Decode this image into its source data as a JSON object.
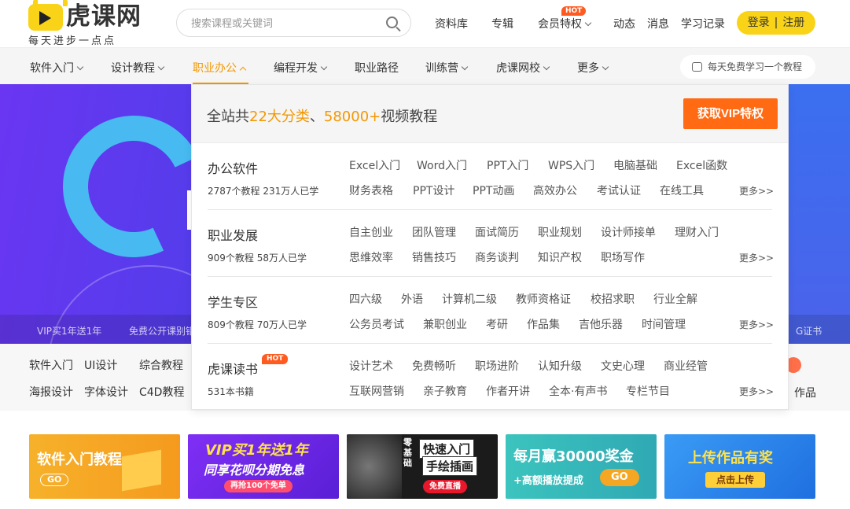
{
  "header": {
    "logo_text": "虎课网",
    "logo_slogan": "每天进步一点点",
    "search_placeholder": "搜索课程或关键词",
    "nav": [
      "资料库",
      "专辑",
      "会员特权",
      "动态",
      "消息",
      "学习记录"
    ],
    "hot_badge": "HOT",
    "login": "登录",
    "register": "注册"
  },
  "navbar": {
    "items": [
      {
        "label": "软件入门",
        "dropdown": true
      },
      {
        "label": "设计教程",
        "dropdown": true
      },
      {
        "label": "职业办公",
        "dropdown": true,
        "active": true
      },
      {
        "label": "编程开发",
        "dropdown": true
      },
      {
        "label": "职业路径",
        "dropdown": false
      },
      {
        "label": "训练营",
        "dropdown": true
      },
      {
        "label": "虎课网校",
        "dropdown": true
      },
      {
        "label": "更多",
        "dropdown": true
      }
    ],
    "daily": "每天免费学习一个教程"
  },
  "banner": {
    "strip": [
      "VIP买1年送1年",
      "免费公开课别错",
      "G证书"
    ]
  },
  "categories": {
    "row1": [
      "软件入门",
      "UI设计",
      "综合教程"
    ],
    "row2": [
      "海报设计",
      "字体设计",
      "C4D教程"
    ],
    "right_label": "作品"
  },
  "dropdown": {
    "title_prefix": "全站共",
    "title_hl1": "22大分类",
    "title_mid": "、",
    "title_hl2": "58000+",
    "title_suffix": "视频教程",
    "vip_button": "获取VIP特权",
    "more": "更多>>",
    "sections": [
      {
        "name": "办公软件",
        "stats": "2787个教程 231万人已学",
        "row1": [
          "Excel入门",
          "Word入门",
          "PPT入门",
          "WPS入门",
          "电脑基础",
          "Excel函数"
        ],
        "row2": [
          "财务表格",
          "PPT设计",
          "PPT动画",
          "高效办公",
          "考试认证",
          "在线工具"
        ]
      },
      {
        "name": "职业发展",
        "stats": "909个教程 58万人已学",
        "row1": [
          "自主创业",
          "团队管理",
          "面试简历",
          "职业规划",
          "设计师接单",
          "理财入门"
        ],
        "row2": [
          "思维效率",
          "销售技巧",
          "商务谈判",
          "知识产权",
          "职场写作"
        ]
      },
      {
        "name": "学生专区",
        "stats": "809个教程 70万人已学",
        "row1": [
          "四六级",
          "外语",
          "计算机二级",
          "教师资格证",
          "校招求职",
          "行业全解"
        ],
        "row2": [
          "公务员考试",
          "兼职创业",
          "考研",
          "作品集",
          "吉他乐器",
          "时间管理"
        ]
      },
      {
        "name": "虎课读书",
        "hot": "HOT",
        "stats": "531本书籍",
        "row1": [
          "设计艺术",
          "免费畅听",
          "职场进阶",
          "认知升级",
          "文史心理",
          "商业经管"
        ],
        "row2": [
          "互联网营销",
          "亲子教育",
          "作者开讲",
          "全本·有声书",
          "专栏节目"
        ]
      }
    ]
  },
  "promos": [
    {
      "title": "软件入门教程",
      "sub": "GO",
      "color": "#f5a623"
    },
    {
      "title": "VIP买1年送1年",
      "sub": "同享花呗分期免息",
      "cta": "再抢100个免单",
      "color": "#7b2ff7"
    },
    {
      "title": "快速入门",
      "sub": "手绘插画",
      "side": "零基础",
      "cta": "免费直播",
      "color": "#1a1a1a"
    },
    {
      "title": "每月赢30000奖金",
      "sub": "+高额播放提成",
      "cta": "GO",
      "color": "#36b7b3"
    },
    {
      "title": "上传作品有奖",
      "cta": "点击上传",
      "color": "#2f8df2"
    }
  ]
}
